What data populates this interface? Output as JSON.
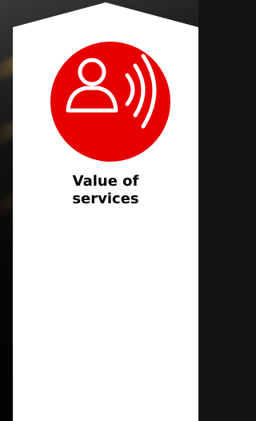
{
  "tile": {
    "icon": "person-soundwave-icon",
    "title_line1": "Value of",
    "title_line2": "services"
  },
  "colors": {
    "accent": "#e60000",
    "card": "#ffffff",
    "text": "#000000"
  }
}
